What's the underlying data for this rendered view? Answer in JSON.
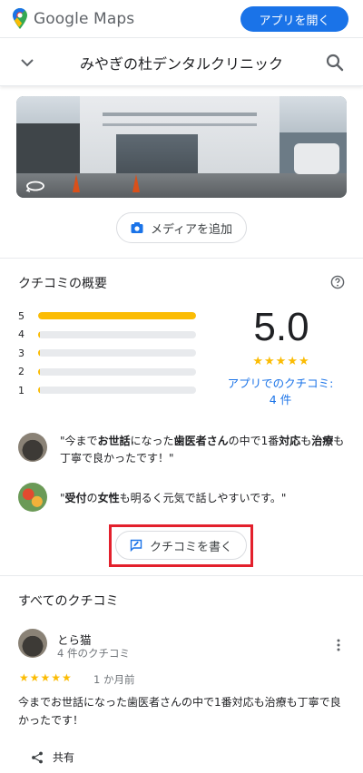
{
  "header": {
    "logo_text": "Google Maps",
    "open_app_label": "アプリを開く"
  },
  "place": {
    "title": "みやぎの杜デンタルクリニック"
  },
  "media": {
    "add_media_label": "メディアを追加"
  },
  "reviews_summary": {
    "title": "クチコミの概要",
    "rating": "5.0",
    "stars": "★★★★★",
    "app_reviews_label": "アプリでのクチコミ: 4 件",
    "bars": [
      {
        "label": "5",
        "fraction": 1.0
      },
      {
        "label": "4",
        "fraction": 0.0
      },
      {
        "label": "3",
        "fraction": 0.0
      },
      {
        "label": "2",
        "fraction": 0.0
      },
      {
        "label": "1",
        "fraction": 0.0
      }
    ]
  },
  "snippets": [
    {
      "parts": [
        "\"今まで",
        "お世話",
        "になった",
        "歯医者さん",
        "の中で1番",
        "対応",
        "も",
        "治療",
        "も丁寧で良かったです！\""
      ]
    },
    {
      "parts": [
        "\"",
        "受付",
        "の",
        "女性",
        "も明るく元気で話しやすいです。\""
      ]
    }
  ],
  "write_review_label": "クチコミを書く",
  "all_reviews": {
    "title": "すべてのクチコミ",
    "review": {
      "author": "とら猫",
      "author_review_count": "4 件のクチコミ",
      "stars": "★★★★★",
      "date": "1 か月前",
      "text": "今までお世話になった歯医者さんの中で1番対応も治療も丁寧で良かったです！",
      "share_label": "共有"
    }
  },
  "colors": {
    "accent": "#1a73e8",
    "star": "#fbbc04",
    "highlight_border": "#e3202c"
  }
}
